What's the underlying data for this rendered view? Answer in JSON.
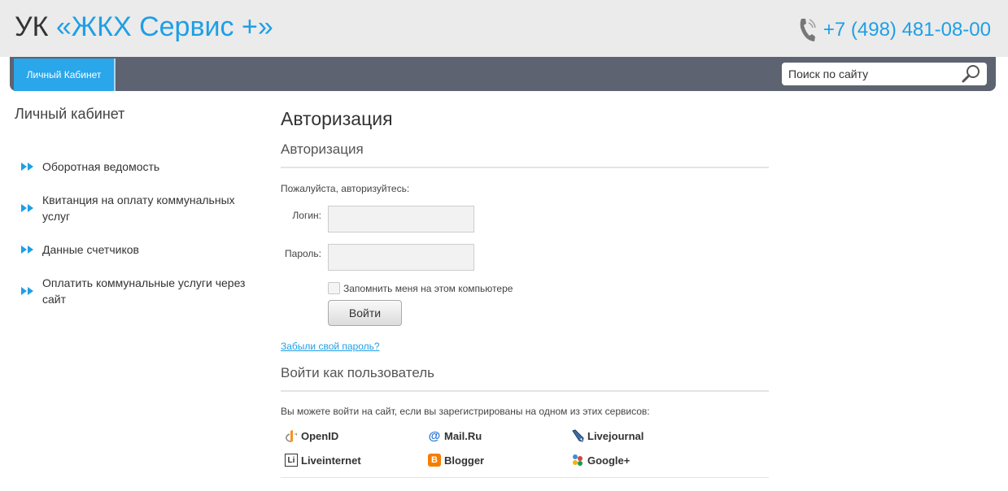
{
  "header": {
    "brand_prefix": "УК",
    "brand_name": "«ЖКХ Сервис +»",
    "phone": "+7 (498) 481-08-00"
  },
  "nav": {
    "tab_label": "Личный Кабинет",
    "search_placeholder": "Поиск по сайту"
  },
  "sidebar": {
    "title": "Личный кабинет",
    "items": [
      {
        "label": "Оборотная ведомость"
      },
      {
        "label": "Квитанция на оплату коммунальных услуг"
      },
      {
        "label": "Данные счетчиков"
      },
      {
        "label": "Оплатить коммунальные услуги через сайт"
      }
    ]
  },
  "main": {
    "title": "Авторизация",
    "subtitle": "Авторизация",
    "hint": "Пожалуйста, авторизуйтесь:",
    "login_label": "Логин:",
    "password_label": "Пароль:",
    "remember_label": "Запомнить меня на этом компьютере",
    "submit_label": "Войти",
    "forgot_link": "Забыли свой пароль?",
    "social_title": "Войти как пользователь",
    "social_hint": "Вы можете войти на сайт, если вы зарегистрированы на одном из этих сервисов:",
    "services": [
      {
        "label": "OpenID",
        "icon": "openid-icon"
      },
      {
        "label": "Mail.Ru",
        "icon": "mailru-icon"
      },
      {
        "label": "Livejournal",
        "icon": "livejournal-icon"
      },
      {
        "label": "Liveinternet",
        "icon": "liveinternet-icon"
      },
      {
        "label": "Blogger",
        "icon": "blogger-icon"
      },
      {
        "label": "Google+",
        "icon": "googleplus-icon"
      }
    ]
  },
  "colors": {
    "accent": "#1e9fe6",
    "nav_bg": "#5d6370",
    "header_bg": "#ebebeb"
  }
}
